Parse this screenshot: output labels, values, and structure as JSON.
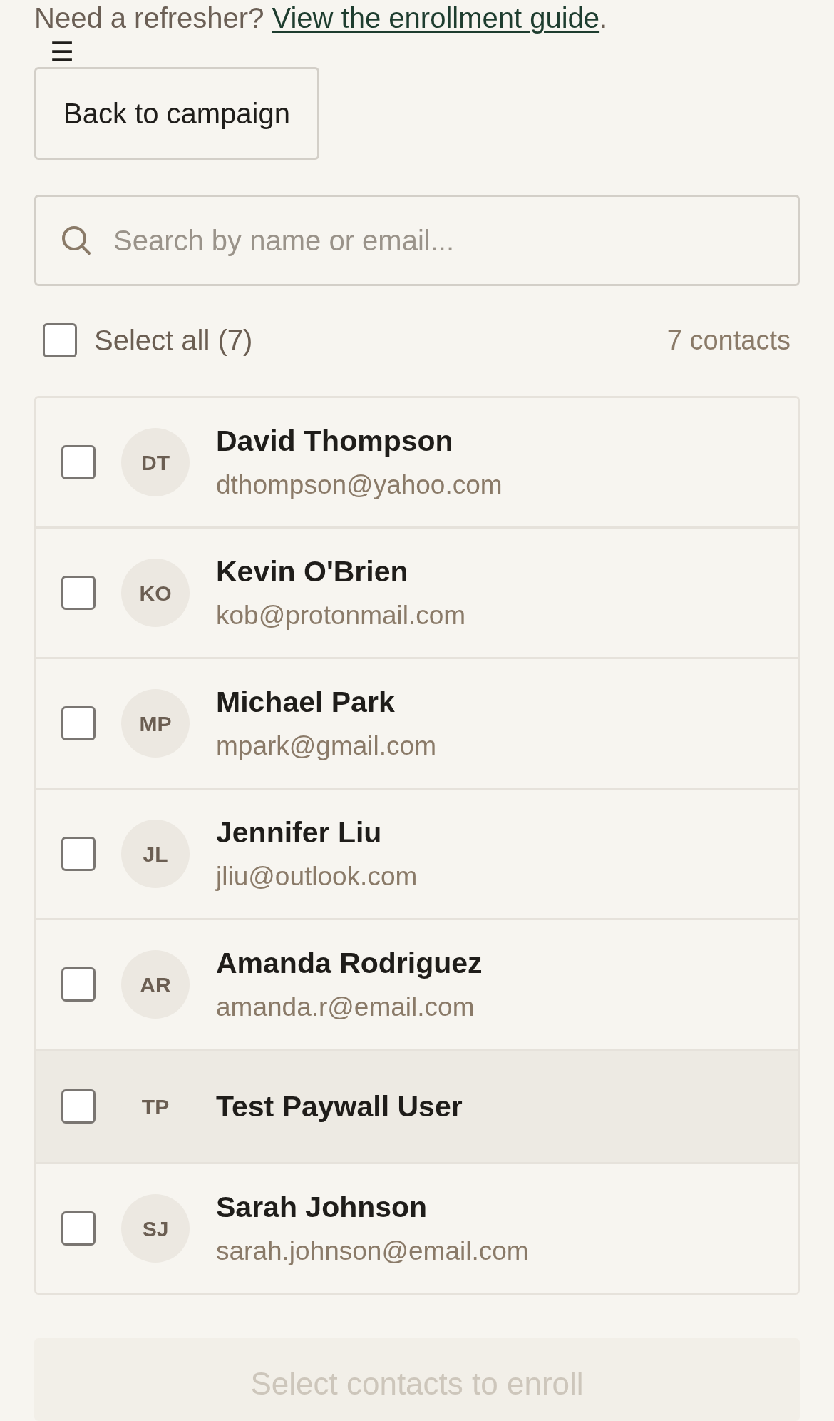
{
  "help": {
    "prompt": "Need a refresher?",
    "link": "View the enrollment guide",
    "end": "."
  },
  "menu_toggle": "☰",
  "back_button": "Back to campaign",
  "search": {
    "placeholder": "Search by name or email..."
  },
  "select_all": {
    "label": "Select all (7)",
    "checked": false
  },
  "count": "7 contacts",
  "contacts": [
    {
      "initials": "DT",
      "name": "David Thompson",
      "email": "dthompson@yahoo.com",
      "checked": false,
      "highlighted": false
    },
    {
      "initials": "KO",
      "name": "Kevin O'Brien",
      "email": "kob@protonmail.com",
      "checked": false,
      "highlighted": false
    },
    {
      "initials": "MP",
      "name": "Michael Park",
      "email": "mpark@gmail.com",
      "checked": false,
      "highlighted": false
    },
    {
      "initials": "JL",
      "name": "Jennifer Liu",
      "email": "jliu@outlook.com",
      "checked": false,
      "highlighted": false
    },
    {
      "initials": "AR",
      "name": "Amanda Rodriguez",
      "email": "amanda.r@email.com",
      "checked": false,
      "highlighted": false
    },
    {
      "initials": "TP",
      "name": "Test Paywall User",
      "checked": false,
      "highlighted": true
    },
    {
      "initials": "SJ",
      "name": "Sarah Johnson",
      "email": "sarah.johnson@email.com",
      "checked": false,
      "highlighted": false
    }
  ],
  "enroll_button": {
    "label": "Select contacts to enroll",
    "disabled": true
  }
}
